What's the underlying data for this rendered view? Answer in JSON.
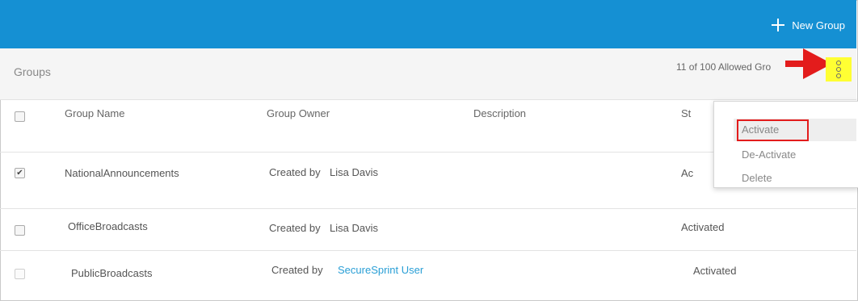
{
  "header": {
    "new_group_label": "New Group"
  },
  "subheader": {
    "title": "Groups",
    "count_text": "11 of 100 Allowed Gro"
  },
  "table": {
    "columns": [
      "Group Name",
      "Group Owner",
      "Description",
      "St"
    ],
    "created_by_label": "Created by",
    "rows": [
      {
        "name": "NationalAnnouncements",
        "owner": "Lisa Davis",
        "status": "Ac",
        "checked": true
      },
      {
        "name": "OfficeBroadcasts",
        "owner": "Lisa Davis",
        "status": "Activated",
        "checked": false
      },
      {
        "name": "PublicBroadcasts",
        "owner": "SecureSprint User",
        "status": "Activated",
        "checked": false
      }
    ]
  },
  "menu": {
    "items": [
      "Activate",
      "De-Activate",
      "Delete"
    ]
  },
  "icons": {
    "new_group": "plus-icon",
    "more_actions": "kebab-menu-icon",
    "check": "✔"
  },
  "colors": {
    "topbar": "#1590d3",
    "link": "#2a9fd6",
    "highlight": "#ffff33",
    "annotation": "#e31c1c"
  }
}
